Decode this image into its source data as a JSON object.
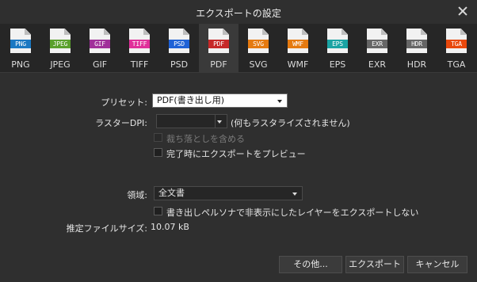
{
  "window": {
    "title": "エクスポートの設定"
  },
  "formats": [
    {
      "badge": "PNG",
      "label": "PNG",
      "color": "#1a78c2",
      "active": false
    },
    {
      "badge": "JPEG",
      "label": "JPEG",
      "color": "#5aa02c",
      "active": false
    },
    {
      "badge": "GIF",
      "label": "GIF",
      "color": "#a0309a",
      "active": false
    },
    {
      "badge": "TIFF",
      "label": "TIFF",
      "color": "#e0309a",
      "active": false
    },
    {
      "badge": "PSD",
      "label": "PSD",
      "color": "#1f62d6",
      "active": false
    },
    {
      "badge": "PDF",
      "label": "PDF",
      "color": "#c62828",
      "active": true
    },
    {
      "badge": "SVG",
      "label": "SVG",
      "color": "#e57a10",
      "active": false
    },
    {
      "badge": "WMF",
      "label": "WMF",
      "color": "#e57a10",
      "active": false
    },
    {
      "badge": "EPS",
      "label": "EPS",
      "color": "#1aa3a3",
      "active": false
    },
    {
      "badge": "EXR",
      "label": "EXR",
      "color": "#666666",
      "active": false
    },
    {
      "badge": "HDR",
      "label": "HDR",
      "color": "#666666",
      "active": false
    },
    {
      "badge": "TGA",
      "label": "TGA",
      "color": "#e8480c",
      "active": false
    }
  ],
  "preset": {
    "label": "プリセット:",
    "value": "PDF(書き出し用)"
  },
  "raster_dpi": {
    "label": "ラスターDPI:",
    "value": "",
    "note": "(何もラスタライズされません)"
  },
  "options": {
    "bleed": {
      "label": "裁ち落としを含める",
      "checked": false,
      "disabled": true
    },
    "preview": {
      "label": "完了時にエクスポートをプレビュー",
      "checked": false,
      "disabled": false
    }
  },
  "area": {
    "label": "領域:",
    "value": "全文書"
  },
  "hidden_layers": {
    "label": "書き出しペルソナで非表示にしたレイヤーをエクスポートしない",
    "checked": false
  },
  "estimate": {
    "label": "推定ファイルサイズ:",
    "value": "10.07 kB"
  },
  "buttons": {
    "more": "その他...",
    "export": "エクスポート",
    "cancel": "キャンセル"
  }
}
